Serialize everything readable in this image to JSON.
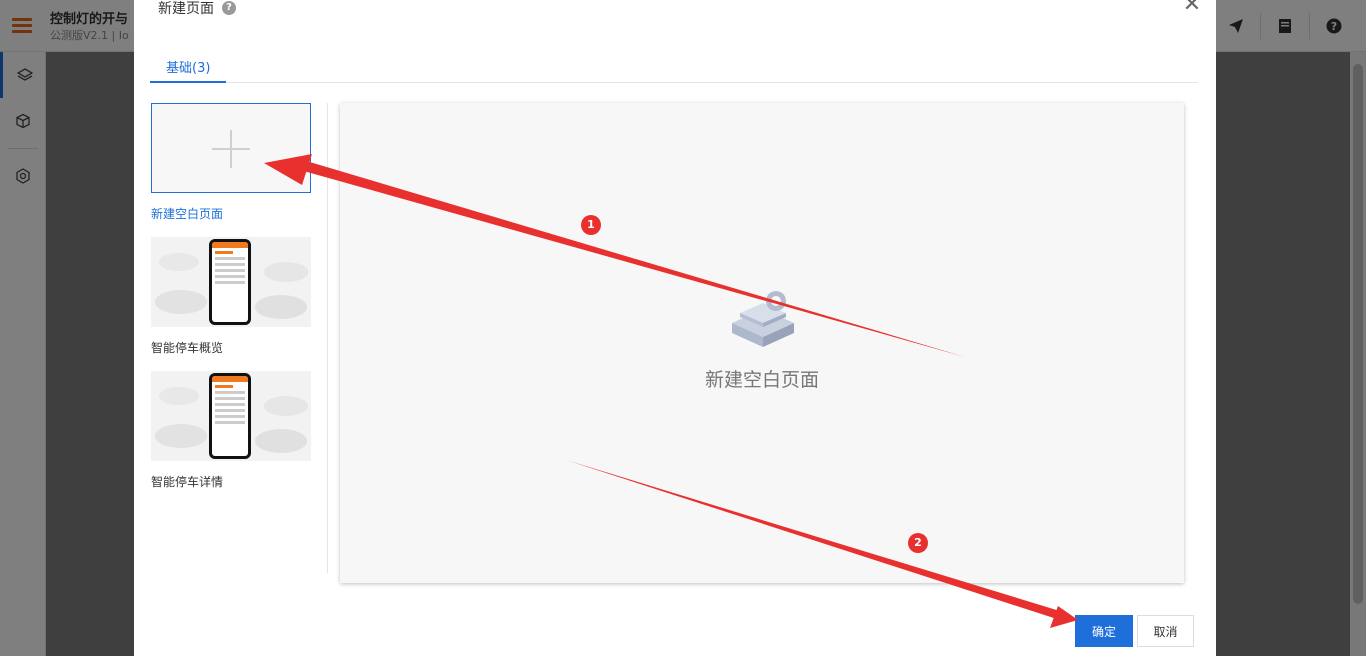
{
  "app": {
    "title": "控制灯的开与",
    "subtitle": "公测版V2.1 | Io",
    "header_icons": [
      "send-icon",
      "document-icon",
      "help-icon"
    ],
    "sidebar_icons": [
      "layers-icon",
      "cube-icon",
      "settings-icon"
    ]
  },
  "dialog": {
    "title": "新建页面",
    "close": "✕",
    "tab": "基础(3)",
    "templates": [
      {
        "label": "新建空白页面"
      },
      {
        "label": "智能停车概览"
      },
      {
        "label": "智能停车详情"
      }
    ],
    "preview_text": "新建空白页面",
    "ok_label": "确定",
    "cancel_label": "取消"
  },
  "annotations": {
    "badge1": "1",
    "badge2": "2",
    "color": "#e8312f"
  },
  "colors": {
    "accent": "#1e6fd9",
    "brand": "#e8641b"
  }
}
